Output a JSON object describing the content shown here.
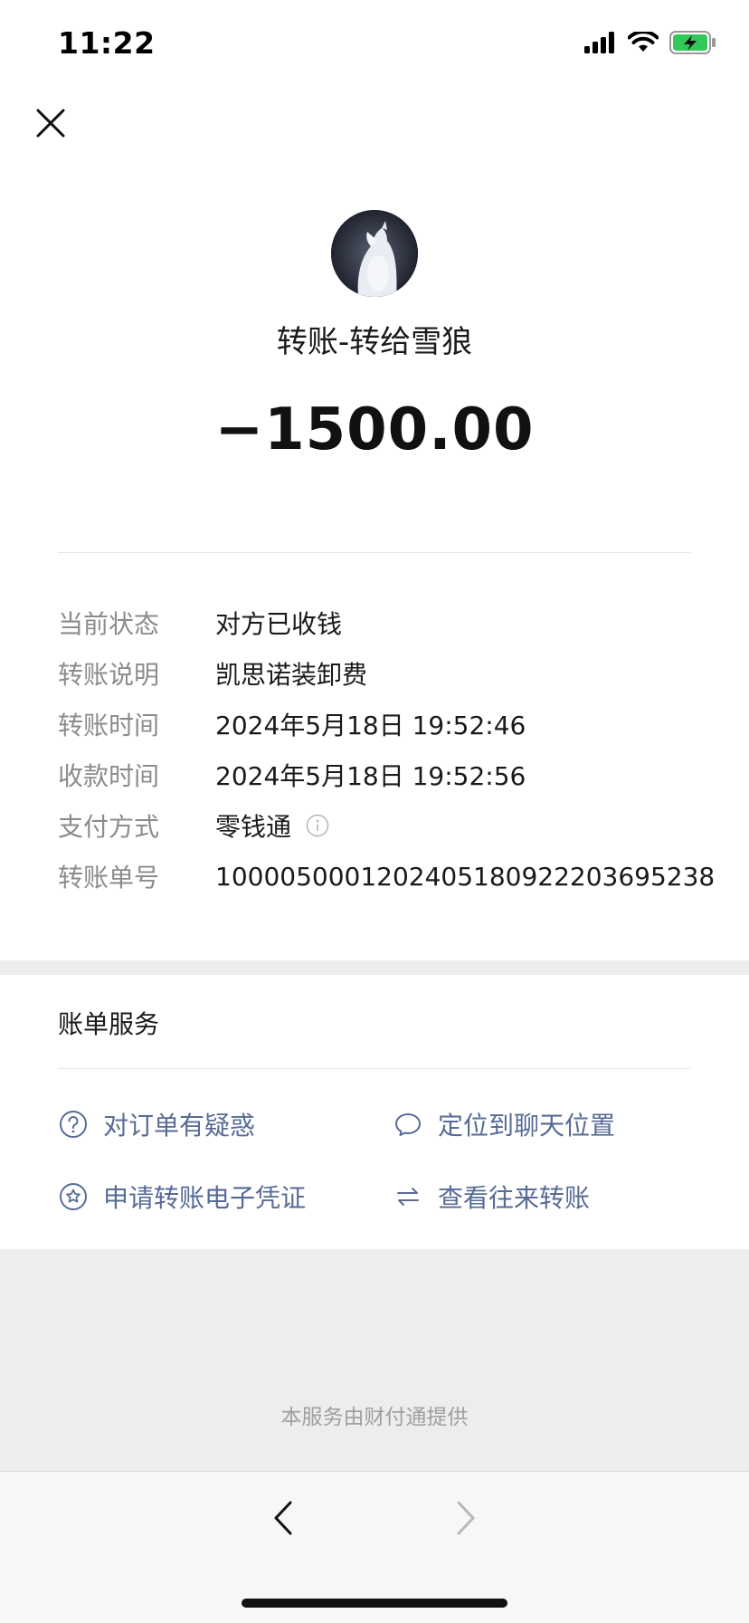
{
  "status_bar": {
    "time": "11:22",
    "icons": [
      "signal-icon",
      "wifi-icon",
      "battery-charging-icon"
    ],
    "battery_color": "#34c759"
  },
  "header": {
    "close_icon": "close-icon",
    "title": "转账-转给雪狼",
    "amount": "−1500.00"
  },
  "details": [
    {
      "label": "当前状态",
      "value": "对方已收钱"
    },
    {
      "label": "转账说明",
      "value": "凯思诺装卸费"
    },
    {
      "label": "转账时间",
      "value": "2024年5月18日 19:52:46"
    },
    {
      "label": "收款时间",
      "value": "2024年5月18日 19:52:56"
    },
    {
      "label": "支付方式",
      "value": "零钱通",
      "icon": "info-icon"
    },
    {
      "label": "转账单号",
      "value": "100005000120240518092220369523‌8"
    }
  ],
  "services": {
    "title": "账单服务",
    "link_color": "#576b95",
    "items": [
      {
        "label": "对订单有疑惑",
        "icon": "question-circle-icon"
      },
      {
        "label": "定位到聊天位置",
        "icon": "chat-bubble-icon"
      },
      {
        "label": "申请转账电子凭证",
        "icon": "star-circle-icon"
      },
      {
        "label": "查看往来转账",
        "icon": "swap-arrows-icon"
      }
    ]
  },
  "footer": {
    "provider_note": "本服务由财付通提供",
    "back_icon": "chevron-left-icon",
    "forward_icon": "chevron-right-icon"
  }
}
